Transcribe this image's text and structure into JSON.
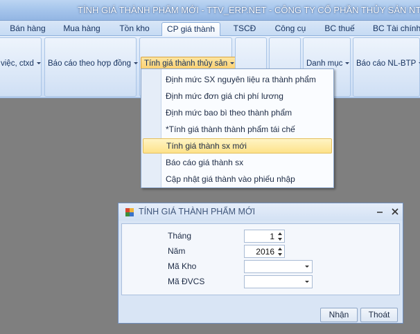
{
  "window": {
    "title": "TÍNH GIÁ THÀNH PHẨM MỚI - TTV_ERP.NET - CÔNG TY CỔ PHẦN THỦY SẢN NTSF"
  },
  "tabs": [
    {
      "label": "Bán hàng"
    },
    {
      "label": "Mua hàng"
    },
    {
      "label": "Tồn kho"
    },
    {
      "label": "CP giá thành"
    },
    {
      "label": "TSCĐ"
    },
    {
      "label": "Công cụ"
    },
    {
      "label": "BC thuế"
    },
    {
      "label": "BC Tài chính"
    }
  ],
  "active_tab": "CP giá thành",
  "ribbon": {
    "buttons": {
      "cong_viec": "việc, ctxd",
      "bao_cao_hop_dong": "Báo cáo theo hợp đồng",
      "tinh_gia_thuy_san": "Tính giá thành thủy sản",
      "danh_muc": "Danh mục",
      "bao_cao_nl_btp": "Báo cáo NL-BTP"
    }
  },
  "menu": {
    "items": [
      {
        "label": "Định mức SX nguyên liệu ra thành phẩm"
      },
      {
        "label": "Định mức đơn giá chi phí lương"
      },
      {
        "label": "Định mức bao bì theo thành phẩm"
      },
      {
        "label": "*Tính giá thành thành phẩm tái chế"
      },
      {
        "label": "Tính giá thành sx mới"
      },
      {
        "label": "Báo cáo  giá thành sx"
      },
      {
        "label": "Cập nhật giá thành vào phiếu nhập"
      }
    ],
    "highlighted": "Tính giá thành sx mới"
  },
  "dialog": {
    "title": "TÍNH GIÁ THÀNH PHẨM MỚI",
    "fields": {
      "thang": {
        "label": "Tháng",
        "value": "1"
      },
      "nam": {
        "label": "Năm",
        "value": "2016"
      },
      "ma_kho": {
        "label": "Mã Kho",
        "value": ""
      },
      "ma_dvcs": {
        "label": "Mã ĐVCS",
        "value": ""
      }
    },
    "buttons": {
      "ok": "Nhận",
      "exit": "Thoát"
    }
  },
  "colors": {
    "accent": "#fbcf6e",
    "ribbon": "#d5e4f7",
    "background": "#7f7f7f"
  },
  "icons": [
    "app-icon",
    "minimize-icon",
    "close-icon",
    "spin-up-icon",
    "spin-down-icon",
    "dropdown-arrow-icon"
  ]
}
